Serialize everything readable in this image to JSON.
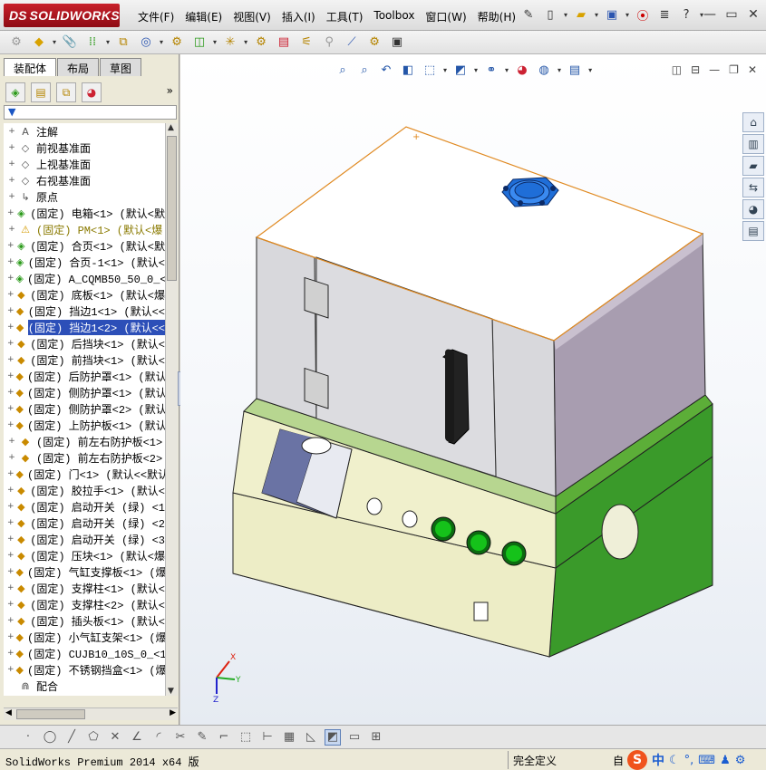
{
  "app": {
    "brand_prefix": "DS",
    "brand": "SOLIDWORKS"
  },
  "menu": [
    "文件(F)",
    "编辑(E)",
    "视图(V)",
    "插入(I)",
    "工具(T)",
    "Toolbox",
    "窗口(W)",
    "帮助(H)"
  ],
  "window_controls": {
    "minimize": "—",
    "restore": "▭",
    "close": "✕"
  },
  "left_tabs": [
    "装配体",
    "布局",
    "草图"
  ],
  "tree": [
    {
      "label": "注解",
      "icon": "annotation-icon",
      "kind": "plane",
      "glyph": "A"
    },
    {
      "label": "前视基准面",
      "icon": "plane-icon",
      "kind": "plane",
      "glyph": "◇"
    },
    {
      "label": "上视基准面",
      "icon": "plane-icon",
      "kind": "plane",
      "glyph": "◇"
    },
    {
      "label": "右视基准面",
      "icon": "plane-icon",
      "kind": "plane",
      "glyph": "◇"
    },
    {
      "label": "原点",
      "icon": "origin-icon",
      "kind": "plane",
      "glyph": "↳"
    },
    {
      "label": "(固定) 电箱<1> (默认<默",
      "icon": "assembly-icon",
      "kind": "asm",
      "glyph": "◈"
    },
    {
      "label": "(固定) PM<1> (默认<爆",
      "icon": "warning-icon",
      "kind": "warn",
      "glyph": "⚠"
    },
    {
      "label": "(固定) 合页<1> (默认<默",
      "icon": "assembly-icon",
      "kind": "asm",
      "glyph": "◈"
    },
    {
      "label": "(固定) 合页-1<1> (默认<",
      "icon": "assembly-icon",
      "kind": "asm",
      "glyph": "◈"
    },
    {
      "label": "(固定) A_CQMB50_50_0_<1",
      "icon": "assembly-icon",
      "kind": "asm",
      "glyph": "◈"
    },
    {
      "label": "(固定) 底板<1> (默认<爆",
      "icon": "part-icon",
      "kind": "part",
      "glyph": "◆"
    },
    {
      "label": "(固定) 挡边1<1> (默认<<",
      "icon": "part-icon",
      "kind": "part",
      "glyph": "◆"
    },
    {
      "label": "(固定) 挡边1<2> (默认<<",
      "icon": "part-icon",
      "kind": "part",
      "glyph": "◆",
      "selected": true
    },
    {
      "label": "(固定) 后挡块<1> (默认<",
      "icon": "part-icon",
      "kind": "part",
      "glyph": "◆"
    },
    {
      "label": "(固定) 前挡块<1> (默认<",
      "icon": "part-icon",
      "kind": "part",
      "glyph": "◆"
    },
    {
      "label": "(固定) 后防护罩<1> (默认",
      "icon": "part-icon",
      "kind": "part",
      "glyph": "◆"
    },
    {
      "label": "(固定) 侧防护罩<1> (默认",
      "icon": "part-icon",
      "kind": "part",
      "glyph": "◆"
    },
    {
      "label": "(固定) 侧防护罩<2> (默认",
      "icon": "part-icon",
      "kind": "part",
      "glyph": "◆"
    },
    {
      "label": "(固定) 上防护板<1> (默认",
      "icon": "part-icon",
      "kind": "part",
      "glyph": "◆"
    },
    {
      "label": "(固定) 前左右防护板<1>",
      "icon": "part-icon",
      "kind": "part",
      "glyph": "◆"
    },
    {
      "label": "(固定) 前左右防护板<2>",
      "icon": "part-icon",
      "kind": "part",
      "glyph": "◆"
    },
    {
      "label": "(固定) 门<1> (默认<<默认",
      "icon": "part-icon",
      "kind": "part",
      "glyph": "◆"
    },
    {
      "label": "(固定) 胶拉手<1> (默认<",
      "icon": "part-icon",
      "kind": "part",
      "glyph": "◆"
    },
    {
      "label": "(固定) 启动开关 (绿) <1",
      "icon": "part-icon",
      "kind": "part",
      "glyph": "◆"
    },
    {
      "label": "(固定) 启动开关 (绿) <2",
      "icon": "part-icon",
      "kind": "part",
      "glyph": "◆"
    },
    {
      "label": "(固定) 启动开关 (绿) <3",
      "icon": "part-icon",
      "kind": "part",
      "glyph": "◆"
    },
    {
      "label": "(固定) 压块<1> (默认<爆",
      "icon": "part-icon",
      "kind": "part",
      "glyph": "◆"
    },
    {
      "label": "(固定) 气缸支撑板<1> (爆",
      "icon": "part-icon",
      "kind": "part",
      "glyph": "◆"
    },
    {
      "label": "(固定) 支撑柱<1> (默认<",
      "icon": "part-icon",
      "kind": "part",
      "glyph": "◆"
    },
    {
      "label": "(固定) 支撑柱<2> (默认<",
      "icon": "part-icon",
      "kind": "part",
      "glyph": "◆"
    },
    {
      "label": "(固定) 插头板<1> (默认<",
      "icon": "part-icon",
      "kind": "part",
      "glyph": "◆"
    },
    {
      "label": "(固定) 小气缸支架<1> (爆",
      "icon": "part-icon",
      "kind": "part",
      "glyph": "◆"
    },
    {
      "label": "(固定) CUJB10_10S_0_<1>",
      "icon": "part-icon",
      "kind": "part",
      "glyph": "◆"
    },
    {
      "label": "(固定) 不锈钢挡盒<1> (爆",
      "icon": "part-icon",
      "kind": "part",
      "glyph": "◆"
    },
    {
      "label": "配合",
      "icon": "mates-icon",
      "kind": "plane",
      "glyph": "⋒",
      "no_expand": true
    }
  ],
  "triad": {
    "x": "X",
    "y": "Y",
    "z": "Z"
  },
  "status": {
    "product": "SolidWorks Premium 2014 x64 版",
    "definition": "完全定义",
    "units": "自"
  },
  "ime": {
    "logo": "S",
    "lang": "中"
  },
  "colors": {
    "selection": "#2c4fb8",
    "body_green": "#3a9a2a",
    "panel_cream": "#efefc8",
    "enclosure_gray": "#d8d8dc",
    "switch_green": "#15c21a",
    "fan_blue": "#1f6ed8"
  }
}
